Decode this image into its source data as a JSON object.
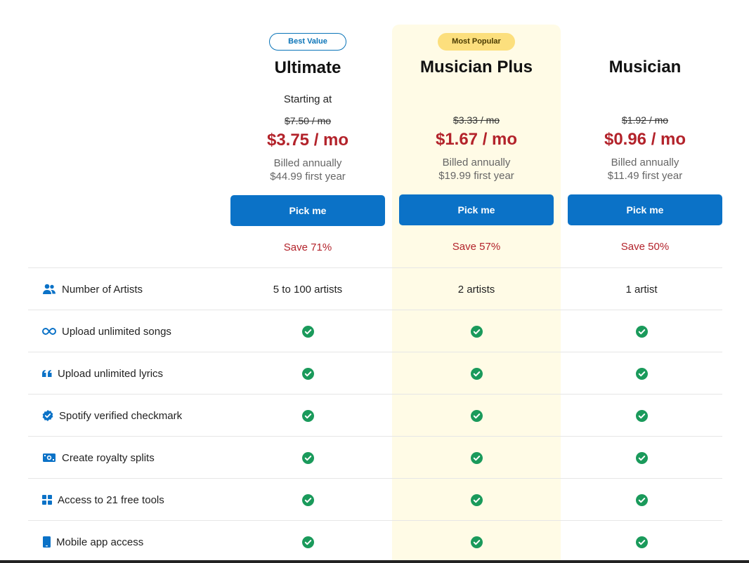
{
  "colors": {
    "accent_blue": "#0b72c7",
    "sale_red": "#b3232b",
    "check_green": "#1a9a5b",
    "highlight_bg": "#fffbe6",
    "popular_badge": "#fcdf7d"
  },
  "plans": [
    {
      "badge": "Best Value",
      "name": "Ultimate",
      "starting": "Starting at",
      "old_price": "$7.50 / mo",
      "price": "$3.75 / mo",
      "billed": "Billed annually",
      "first_year": "$44.99 first year",
      "button": "Pick me",
      "save": "Save 71%"
    },
    {
      "badge": "Most Popular",
      "name": "Musician Plus",
      "old_price": "$3.33 / mo",
      "price": "$1.67 / mo",
      "billed": "Billed annually",
      "first_year": "$19.99 first year",
      "button": "Pick me",
      "save": "Save 57%"
    },
    {
      "name": "Musician",
      "old_price": "$1.92 / mo",
      "price": "$0.96 / mo",
      "billed": "Billed annually",
      "first_year": "$11.49 first year",
      "button": "Pick me",
      "save": "Save 50%"
    }
  ],
  "features": [
    {
      "label": "Number of Artists",
      "icon": "users-icon",
      "values": [
        "5 to 100 artists",
        "2 artists",
        "1 artist"
      ]
    },
    {
      "label": "Upload unlimited songs",
      "icon": "infinity-icon",
      "values": [
        "check",
        "check",
        "check"
      ]
    },
    {
      "label": "Upload unlimited lyrics",
      "icon": "quote-icon",
      "values": [
        "check",
        "check",
        "check"
      ]
    },
    {
      "label": "Spotify verified checkmark",
      "icon": "verified-badge-icon",
      "values": [
        "check",
        "check",
        "check"
      ]
    },
    {
      "label": "Create royalty splits",
      "icon": "money-split-icon",
      "values": [
        "check",
        "check",
        "check"
      ]
    },
    {
      "label": "Access to 21 free tools",
      "icon": "grid-icon",
      "values": [
        "check",
        "check",
        "check"
      ]
    },
    {
      "label": "Mobile app access",
      "icon": "mobile-phone-icon",
      "values": [
        "check",
        "check",
        "check"
      ]
    }
  ]
}
